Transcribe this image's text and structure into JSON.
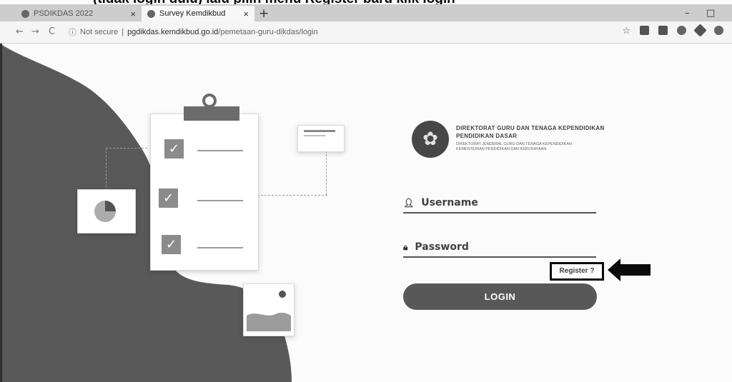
{
  "caption": "(tidak login dulu) lalu pilih menu Register baru klik login",
  "browser": {
    "tabs": [
      {
        "label": "PSDIKDAS 2022",
        "active": false
      },
      {
        "label": "Survey Kemdikbud",
        "active": true
      }
    ],
    "new_tab": "+",
    "nav": {
      "back": "←",
      "forward": "→",
      "reload": "C"
    },
    "security_label": "Not secure",
    "url_host": "pgdikdas.kemdikbud.go.id",
    "url_path": "/pemetaan-guru-dikdas/login",
    "window_min": "–",
    "window_restore": "□",
    "bookmark_star": "☆",
    "toolbar_icons": [
      "printer-icon",
      "save-icon",
      "sync-icon",
      "extensions-icon",
      "profile-icon"
    ]
  },
  "illustration": {
    "checkbox_mark": "✓",
    "items": 3
  },
  "login": {
    "org_line1": "DIREKTORAT GURU DAN TENAGA KEPENDIDIKAN",
    "org_line2": "PENDIDIKAN DASAR",
    "org_sub1": "DIREKTORAT JENDERAL GURU DAN TENAGA KEPENDIDIKAN",
    "org_sub2": "KEMENTERIAN PENDIDIKAN DAN KEBUDAYAAN",
    "username_placeholder": "Username",
    "password_placeholder": "Password",
    "register_link": "Register ?",
    "login_button": "LOGIN"
  },
  "colors": {
    "dark_shape": "#5b5b5b",
    "button": "#5a5a5a",
    "highlight_border": "#111111"
  }
}
